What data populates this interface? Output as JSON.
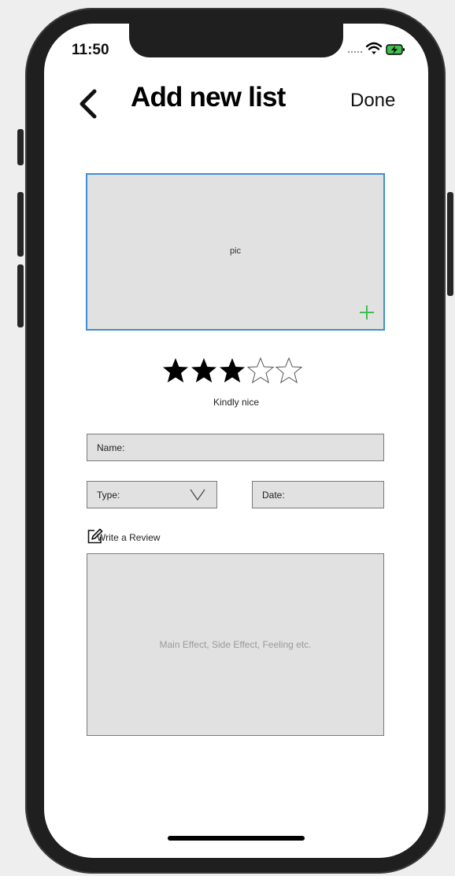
{
  "status_bar": {
    "time": "11:50"
  },
  "nav": {
    "back_icon": "chevron-left-icon",
    "title": "Add new list",
    "done_label": "Done"
  },
  "photo": {
    "label": "pic",
    "add_icon": "plus-icon",
    "accent_color": "#3c8fd6",
    "add_color": "#3fbf4e"
  },
  "rating": {
    "value": 3,
    "max": 5,
    "label": "Kindly nice"
  },
  "form": {
    "name_label": "Name:",
    "type_label": "Type:",
    "date_label": "Date:"
  },
  "review": {
    "icon": "edit-icon",
    "label": "Write a Review",
    "placeholder": "Main Effect, Side Effect, Feeling etc."
  }
}
